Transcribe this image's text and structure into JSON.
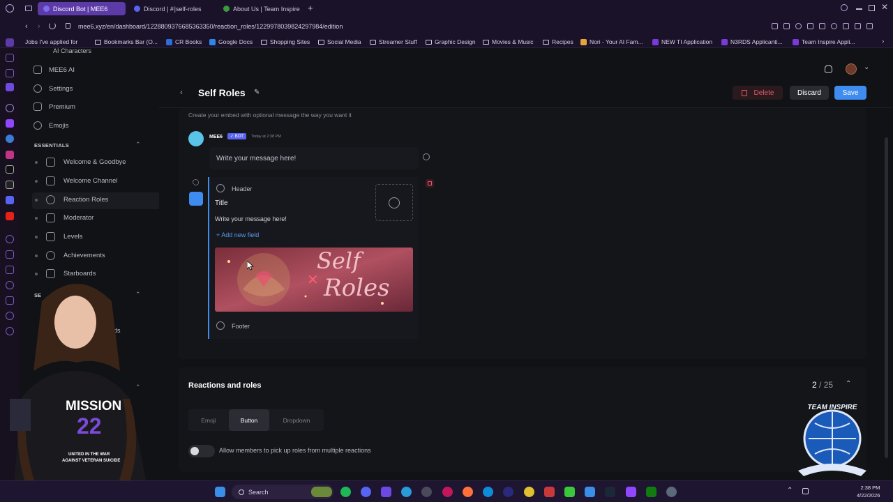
{
  "browser": {
    "tabs": [
      {
        "label": "Discord Bot | MEE6",
        "active": true,
        "color": "#7c6cf0"
      },
      {
        "label": "Discord | # |self-roles",
        "active": false,
        "color": "#5865f2"
      },
      {
        "label": "About Us | Team Inspire",
        "active": false,
        "color": "#3c9a3c"
      }
    ],
    "url": "mee6.xyz/en/dashboard/1228809376685363350/reaction_roles/1229978039824297984/edition",
    "bookmarks": [
      "Jobs I've applied for",
      "Bookmarks Bar (O...",
      "CR Books",
      "Google Docs",
      "Shopping Sites",
      "Social Media",
      "Streamer Stuff",
      "Graphic Design",
      "Movies & Music",
      "Recipes",
      "Nori - Your AI Fam...",
      "NEW TI Application",
      "N3RDS Applicanti...",
      "Team Inspire Appli..."
    ]
  },
  "sidebar": {
    "top_partial": "AI Characters",
    "items": [
      {
        "label": "MEE6 AI",
        "icon": "sparkle-icon"
      },
      {
        "label": "Settings",
        "icon": "gear-icon"
      },
      {
        "label": "Premium",
        "icon": "crown-icon"
      },
      {
        "label": "Emojis",
        "icon": "smile-icon"
      }
    ],
    "section_essentials": "ESSENTIALS",
    "essentials": [
      {
        "label": "Welcome & Goodbye",
        "icon": "hand-icon"
      },
      {
        "label": "Welcome Channel",
        "icon": "channel-icon"
      },
      {
        "label": "Reaction Roles",
        "icon": "reaction-icon",
        "selected": true
      },
      {
        "label": "Moderator",
        "icon": "hammer-icon"
      },
      {
        "label": "Levels",
        "icon": "levels-icon"
      },
      {
        "label": "Achievements",
        "icon": "medal-icon"
      },
      {
        "label": "Starboards",
        "icon": "star-icon"
      }
    ],
    "section_partial": "SE",
    "partial_item": "ads"
  },
  "main": {
    "title": "Self Roles",
    "buttons": {
      "delete": "Delete",
      "discard": "Discard",
      "save": "Save"
    },
    "embed_hint": "Create your embed with optional message the way you want it",
    "bot_name": "MEE6",
    "bot_badge": "✓ BOT",
    "timestamp": "Today at 2:38 PM",
    "message_placeholder": "Write your message here!",
    "embed": {
      "header": "Header",
      "title": "Title",
      "description": "Write your message here!",
      "add_field": "+ Add new field",
      "image_text_line1": "Self",
      "image_text_line2": "Roles",
      "footer": "Footer"
    },
    "reactions": {
      "title": "Reactions and roles",
      "count_current": "2",
      "count_sep": "/ 25",
      "tabs": [
        "Emoji",
        "Button",
        "Dropdown"
      ],
      "active_tab": "Button",
      "toggle_label": "Allow members to pick up roles from multiple reactions"
    }
  },
  "overlay": {
    "shirt_line1": "MISSION",
    "shirt_line2": "22",
    "shirt_line3": "UNITED IN THE WAR",
    "shirt_line4": "AGAINST VETERAN SUICIDE",
    "logo_text": "TEAM INSPIRE"
  },
  "taskbar": {
    "search": "Search",
    "time": "2:38 PM",
    "date": "4/22/2026"
  },
  "colors": {
    "accent": "#3e8cf0",
    "delete": "#e05a6a",
    "browser_purple": "#5c3aa8"
  }
}
